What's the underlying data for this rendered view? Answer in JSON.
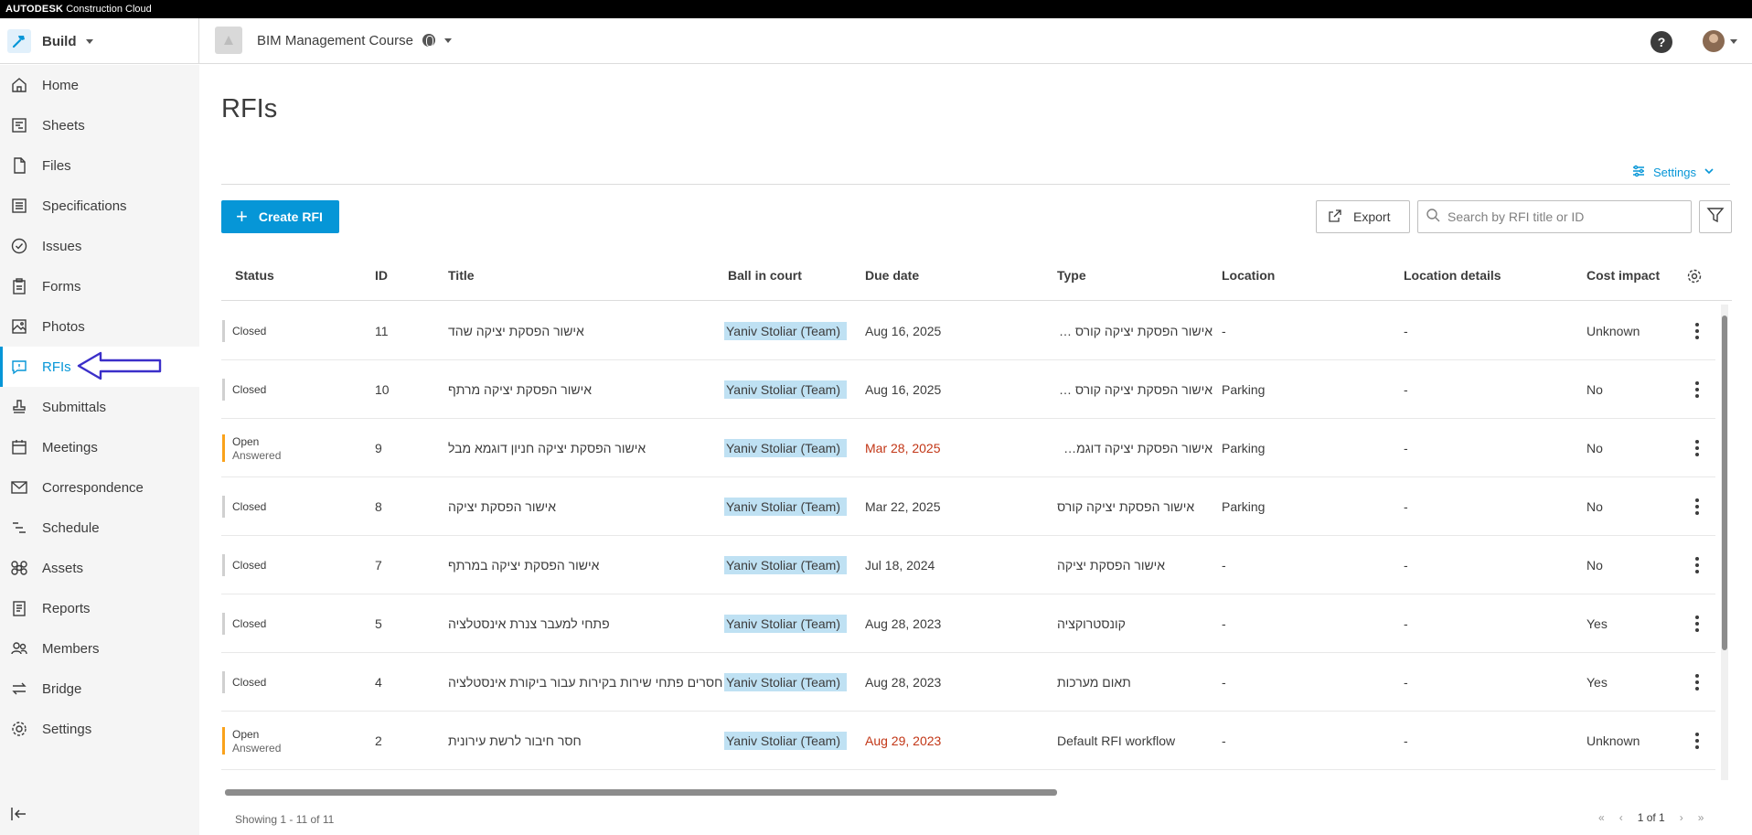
{
  "topbar": {
    "brand": "AUTODESK",
    "product": "Construction Cloud"
  },
  "header": {
    "module": "Build",
    "project": "BIM Management Course",
    "help": "?"
  },
  "sidebar": {
    "items": [
      {
        "label": "Home",
        "icon": "home-icon"
      },
      {
        "label": "Sheets",
        "icon": "sheets-icon"
      },
      {
        "label": "Files",
        "icon": "files-icon"
      },
      {
        "label": "Specifications",
        "icon": "specifications-icon"
      },
      {
        "label": "Issues",
        "icon": "issues-icon"
      },
      {
        "label": "Forms",
        "icon": "forms-icon"
      },
      {
        "label": "Photos",
        "icon": "photos-icon"
      },
      {
        "label": "RFIs",
        "icon": "rfis-icon",
        "active": true
      },
      {
        "label": "Submittals",
        "icon": "submittals-icon"
      },
      {
        "label": "Meetings",
        "icon": "meetings-icon"
      },
      {
        "label": "Correspondence",
        "icon": "correspondence-icon"
      },
      {
        "label": "Schedule",
        "icon": "schedule-icon"
      },
      {
        "label": "Assets",
        "icon": "assets-icon"
      },
      {
        "label": "Reports",
        "icon": "reports-icon"
      },
      {
        "label": "Members",
        "icon": "members-icon"
      },
      {
        "label": "Bridge",
        "icon": "bridge-icon"
      },
      {
        "label": "Settings",
        "icon": "settings-icon"
      }
    ]
  },
  "main": {
    "title": "RFIs",
    "settings_label": "Settings",
    "create_label": "Create RFI",
    "export_label": "Export",
    "search_placeholder": "Search by RFI title or ID",
    "columns": [
      "Status",
      "ID",
      "Title",
      "Ball in court",
      "Due date",
      "Type",
      "Location",
      "Location details",
      "Cost impact"
    ],
    "rows": [
      {
        "status": "Closed",
        "sub": "",
        "id": "11",
        "title": "אישור הפסקת יציקה שהד",
        "bic": "Yaniv Stoliar (Team)",
        "due": "Aug 16, 2025",
        "late": false,
        "type": "אישור הפסקת יציקה קורס דוגמא",
        "location": "-",
        "details": "-",
        "cost": "Unknown"
      },
      {
        "status": "Closed",
        "sub": "",
        "id": "10",
        "title": "אישור הפסקת יציקה מרתף",
        "bic": "Yaniv Stoliar (Team)",
        "due": "Aug 16, 2025",
        "late": false,
        "type": "אישור הפסקת יציקה קורס דוגמא",
        "location": "Parking",
        "details": "-",
        "cost": "No"
      },
      {
        "status": "Open",
        "sub": "Answered",
        "id": "9",
        "title": "אישור הפסקת יציקה חניון דוגמא מבל",
        "bic": "Yaniv Stoliar (Team)",
        "due": "Mar 28, 2025",
        "late": true,
        "type": "אישור הפסקת יציקה דוגמא מבל",
        "location": "Parking",
        "details": "-",
        "cost": "No"
      },
      {
        "status": "Closed",
        "sub": "",
        "id": "8",
        "title": "אישור הפסקת יציקה",
        "bic": "Yaniv Stoliar (Team)",
        "due": "Mar 22, 2025",
        "late": false,
        "type": "אישור הפסקת יציקה קורס",
        "location": "Parking",
        "details": "-",
        "cost": "No"
      },
      {
        "status": "Closed",
        "sub": "",
        "id": "7",
        "title": "אישור הפסקת יציקה במרתף",
        "bic": "Yaniv Stoliar (Team)",
        "due": "Jul 18, 2024",
        "late": false,
        "type": "אישור הפסקת יציקה",
        "location": "-",
        "details": "-",
        "cost": "No"
      },
      {
        "status": "Closed",
        "sub": "",
        "id": "5",
        "title": "פתחי למעבר צנרת אינסטלציה",
        "bic": "Yaniv Stoliar (Team)",
        "due": "Aug 28, 2023",
        "late": false,
        "type": "קונסטרוקציה",
        "location": "-",
        "details": "-",
        "cost": "Yes"
      },
      {
        "status": "Closed",
        "sub": "",
        "id": "4",
        "title": "חסרים פתחי שירות בקירות עבור ביקורת אינסטלציה",
        "bic": "Yaniv Stoliar (Team)",
        "due": "Aug 28, 2023",
        "late": false,
        "type": "תאום מערכות",
        "location": "-",
        "details": "-",
        "cost": "Yes"
      },
      {
        "status": "Open",
        "sub": "Answered",
        "id": "2",
        "title": "חסר חיבור לרשת עירונית",
        "bic": "Yaniv Stoliar (Team)",
        "due": "Aug 29, 2023",
        "late": true,
        "type": "Default RFI workflow",
        "location": "-",
        "details": "-",
        "cost": "Unknown"
      }
    ],
    "footer_count": "Showing 1 - 11 of 11",
    "pager_text": "1 of 1"
  },
  "colors": {
    "accent": "#0696d7",
    "open_status": "#faa21b",
    "late_due": "#c23616",
    "bic_highlight": "#bfe1f3"
  }
}
